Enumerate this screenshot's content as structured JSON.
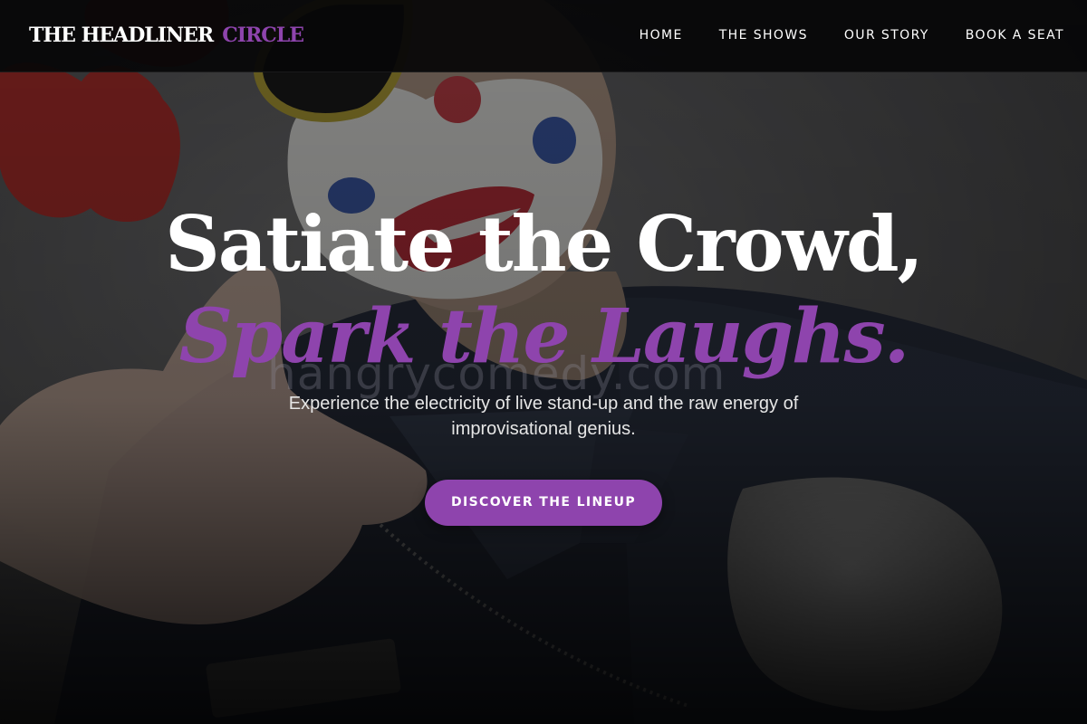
{
  "brand": {
    "name_main": "THE HEADLINER",
    "name_accent": "CIRCLE"
  },
  "nav": {
    "items": [
      {
        "label": "HOME"
      },
      {
        "label": "THE SHOWS"
      },
      {
        "label": "OUR STORY"
      },
      {
        "label": "BOOK A SEAT"
      }
    ]
  },
  "hero": {
    "headline_line1": "Satiate the Crowd,",
    "headline_line2": "Spark the Laughs.",
    "subtitle": "Experience the electricity of live stand-up and the raw energy of improvisational genius.",
    "cta_label": "DISCOVER THE LINEUP",
    "background_watermark": "hangrycomedy.com"
  },
  "colors": {
    "accent": "#8e44ad",
    "nav_background": "#060608",
    "text_primary": "#ffffff"
  }
}
